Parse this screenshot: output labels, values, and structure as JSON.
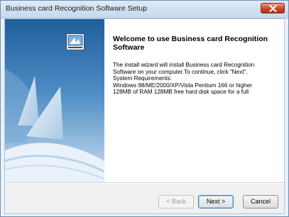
{
  "window": {
    "title": "Business card Recognition Software Setup"
  },
  "icons": {
    "close": "close-icon",
    "setup": "setup-icon"
  },
  "colors": {
    "side_panel_accent": "#3b78b2",
    "close_button": "#c9452c"
  },
  "content": {
    "heading_line1": "Welcome to use Business card Recognition",
    "heading_line2": "Software",
    "lines": [
      "The install wizard will install Business card Recognition",
      "Software on your computer.To continue, click \"Next\".",
      "System Requirements:",
      "Windows 98/ME/2000/XP/Vista Pentium 166 or higher",
      "128MB of RAM 128MB free hard disk space for a full"
    ]
  },
  "buttons": {
    "back": "< Back",
    "next": "Next >",
    "cancel": "Cancel"
  }
}
